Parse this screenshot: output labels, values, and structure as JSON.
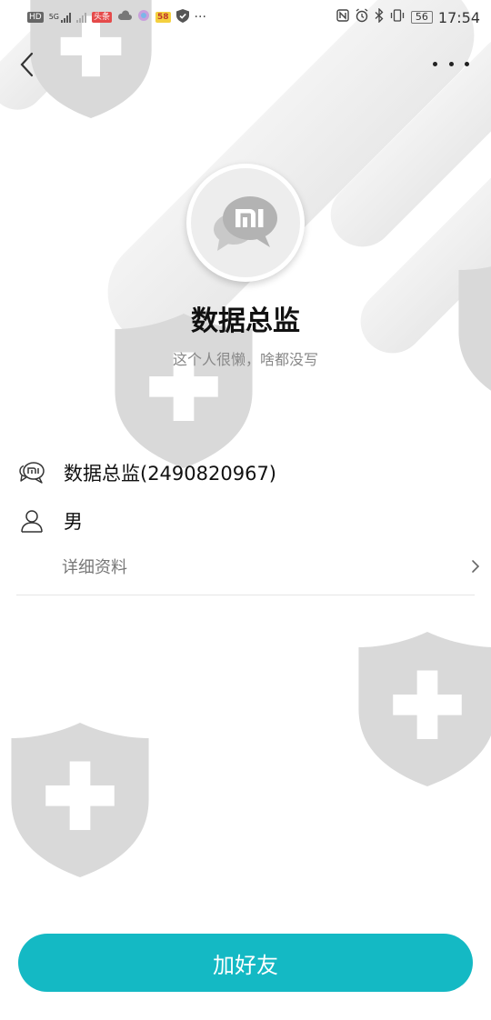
{
  "status_bar": {
    "hd_label": "HD",
    "net_label_1": "5G",
    "red_badge": "头条",
    "badge_58": "58",
    "more_label": "···",
    "battery": "56",
    "time": "17:54"
  },
  "profile": {
    "display_name": "数据总监",
    "signature": "这个人很懒，啥都没写",
    "account": "数据总监(2490820967)",
    "gender": "男",
    "detail_label": "详细资料"
  },
  "actions": {
    "add_friend_label": "加好友"
  },
  "icons": {
    "back": "chevron-left-icon",
    "more": "more-horizontal-icon",
    "avatar": "mi-chat-logo",
    "account": "mi-chat-icon",
    "gender": "person-icon",
    "detail_arrow": "chevron-right-icon"
  },
  "colors": {
    "accent": "#14b9c4",
    "watermark": "#d9d9d9",
    "muted_text": "#888888"
  }
}
